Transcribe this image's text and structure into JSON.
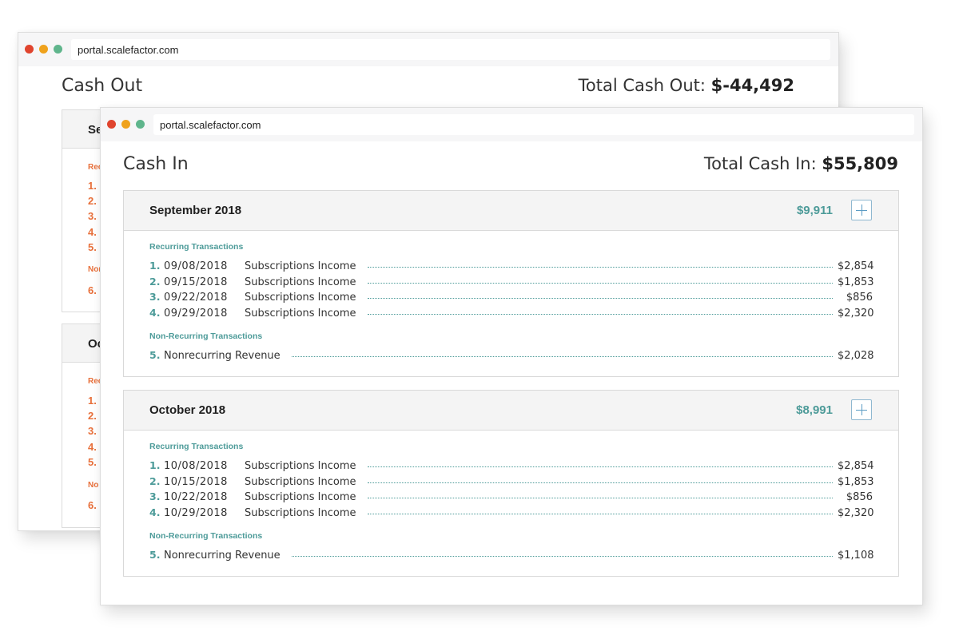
{
  "colors": {
    "dot_red": "#e0442e",
    "dot_yellow": "#efa21c",
    "dot_green": "#5fb58c",
    "accent_teal": "#4d9b99",
    "accent_orange": "#e8703b",
    "plus_blue": "#5b9cc4"
  },
  "back_window": {
    "url": "portal.scalefactor.com",
    "title": "Cash Out",
    "total_label": "Total Cash Out: ",
    "total_value": "$-44,492",
    "cards": [
      {
        "month": "Se",
        "recurring_label": "Rec",
        "nonrecurring_label": "Non",
        "items": [
          "1.",
          "2.",
          "3.",
          "4.",
          "5."
        ],
        "extra_items": [
          "6."
        ]
      },
      {
        "month": "Oc",
        "recurring_label": "Rec",
        "nonrecurring_label": "No",
        "items": [
          "1.",
          "2.",
          "3.",
          "4.",
          "5."
        ],
        "extra_items": [
          "6."
        ]
      }
    ]
  },
  "front_window": {
    "url": "portal.scalefactor.com",
    "title": "Cash In",
    "total_label": "Total Cash In: ",
    "total_value": "$55,809",
    "months": [
      {
        "name": "September 2018",
        "total": "$9,911",
        "recurring_label": "Recurring Transactions",
        "recurring": [
          {
            "idx": "1.",
            "date": "09/08/2018",
            "desc": "Subscriptions Income",
            "amount": "$2,854"
          },
          {
            "idx": "2.",
            "date": "09/15/2018",
            "desc": "Subscriptions Income",
            "amount": "$1,853"
          },
          {
            "idx": "3.",
            "date": "09/22/2018",
            "desc": "Subscriptions Income",
            "amount": "$856"
          },
          {
            "idx": "4.",
            "date": "09/29/2018",
            "desc": "Subscriptions Income",
            "amount": "$2,320"
          }
        ],
        "nonrecurring_label": "Non-Recurring Transactions",
        "nonrecurring": [
          {
            "idx": "5.",
            "desc": "Nonrecurring Revenue",
            "amount": "$2,028"
          }
        ]
      },
      {
        "name": "October 2018",
        "total": "$8,991",
        "recurring_label": "Recurring Transactions",
        "recurring": [
          {
            "idx": "1.",
            "date": "10/08/2018",
            "desc": "Subscriptions Income",
            "amount": "$2,854"
          },
          {
            "idx": "2.",
            "date": "10/15/2018",
            "desc": "Subscriptions Income",
            "amount": "$1,853"
          },
          {
            "idx": "3.",
            "date": "10/22/2018",
            "desc": "Subscriptions Income",
            "amount": "$856"
          },
          {
            "idx": "4.",
            "date": "10/29/2018",
            "desc": "Subscriptions Income",
            "amount": "$2,320"
          }
        ],
        "nonrecurring_label": "Non-Recurring Transactions",
        "nonrecurring": [
          {
            "idx": "5.",
            "desc": "Nonrecurring Revenue",
            "amount": "$1,108"
          }
        ]
      }
    ]
  }
}
